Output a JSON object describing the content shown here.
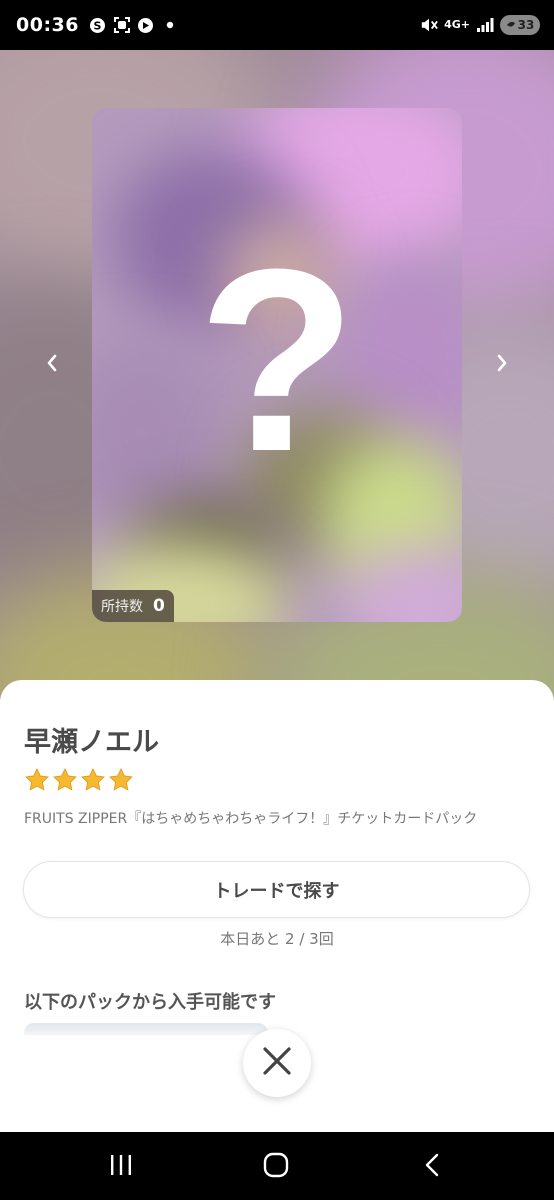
{
  "status_bar": {
    "time": "00:36",
    "network": "4G+",
    "battery": "33",
    "icons": [
      "skype-icon",
      "screen-record-icon",
      "app-icon",
      "dot-icon",
      "mute-icon",
      "signal-icon",
      "battery-icon"
    ]
  },
  "card": {
    "placeholder_symbol": "?",
    "owned_label": "所持数",
    "owned_count": "0",
    "prev_icon": "chevron-left-icon",
    "next_icon": "chevron-right-icon"
  },
  "sheet": {
    "character_name": "早瀬ノエル",
    "star_rating": 4,
    "star_color": "#f5b82e",
    "pack_title": "FRUITS ZIPPER『はちゃめちゃわちゃライフ！』チケットカードパック",
    "trade_button_label": "トレードで探す",
    "trade_remaining": "本日あと 2 / 3回",
    "available_heading": "以下のパックから入手可能です",
    "close_icon": "close-icon"
  },
  "nav_bar": {
    "icons": [
      "recent-apps-icon",
      "home-icon",
      "back-icon"
    ]
  }
}
